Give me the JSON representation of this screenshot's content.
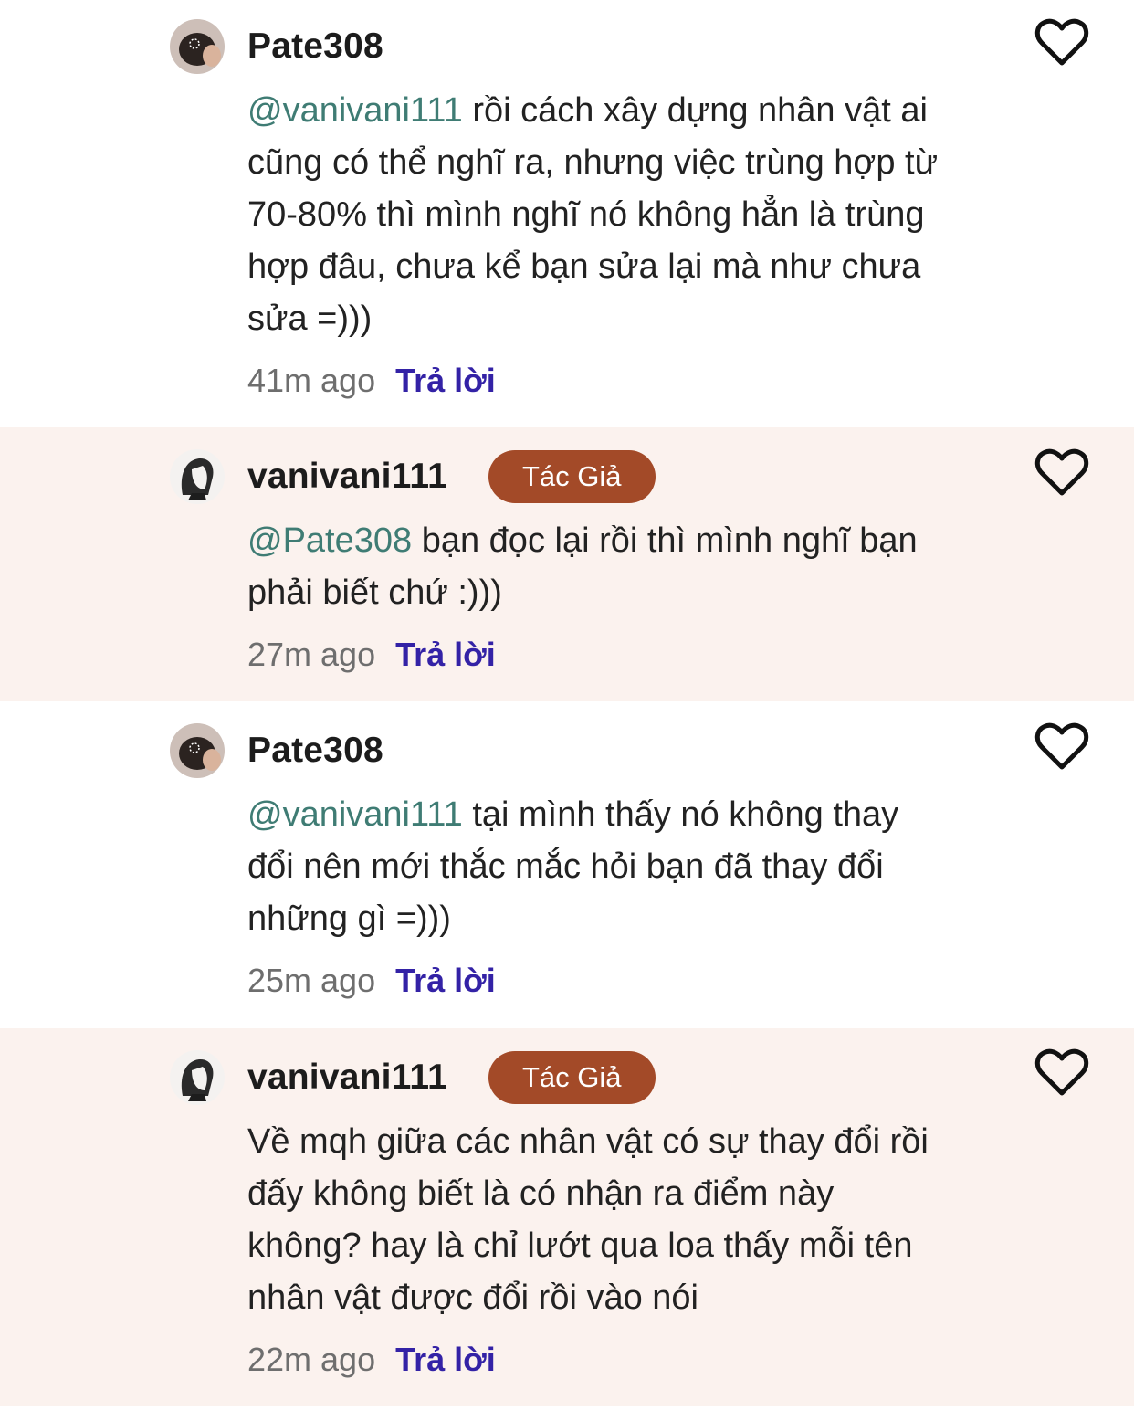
{
  "comments": [
    {
      "username": "Pate308",
      "is_author": false,
      "badge": "",
      "mention": "@vanivani111",
      "text": " rồi cách xây dựng nhân vật ai cũng có thể nghĩ ra, nhưng việc trùng hợp từ 70-80% thì mình nghĩ nó không hẳn là trùng hợp đâu, chưa kể bạn sửa lại mà như chưa sửa =)))",
      "time": "41m ago",
      "reply_label": "Trả lời",
      "like_icon": "heart-outline-icon"
    },
    {
      "username": "vanivani111",
      "is_author": true,
      "badge": "Tác Giả",
      "mention": "@Pate308",
      "text": " bạn đọc lại rồi thì mình nghĩ bạn phải biết chứ :)))",
      "time": "27m ago",
      "reply_label": "Trả lời",
      "like_icon": "heart-outline-icon"
    },
    {
      "username": "Pate308",
      "is_author": false,
      "badge": "",
      "mention": "@vanivani111",
      "text": " tại mình thấy nó không thay đổi nên mới thắc mắc hỏi bạn đã thay đổi những gì =)))",
      "time": "25m ago",
      "reply_label": "Trả lời",
      "like_icon": "heart-outline-icon"
    },
    {
      "username": "vanivani111",
      "is_author": true,
      "badge": "Tác Giả",
      "mention": "",
      "text": "Về mqh giữa các nhân vật có sự thay đổi rồi đấy không biết là có nhận ra điểm này không? hay là chỉ lướt qua loa thấy mỗi tên nhân vật được đổi rồi vào nói",
      "time": "22m ago",
      "reply_label": "Trả lời",
      "like_icon": "heart-outline-icon"
    }
  ],
  "colors": {
    "author_background": "#fbf2ee",
    "badge": "#a34a28",
    "mention": "#3f7c74",
    "reply": "#3322a6",
    "timestamp": "#6e6e6e"
  }
}
